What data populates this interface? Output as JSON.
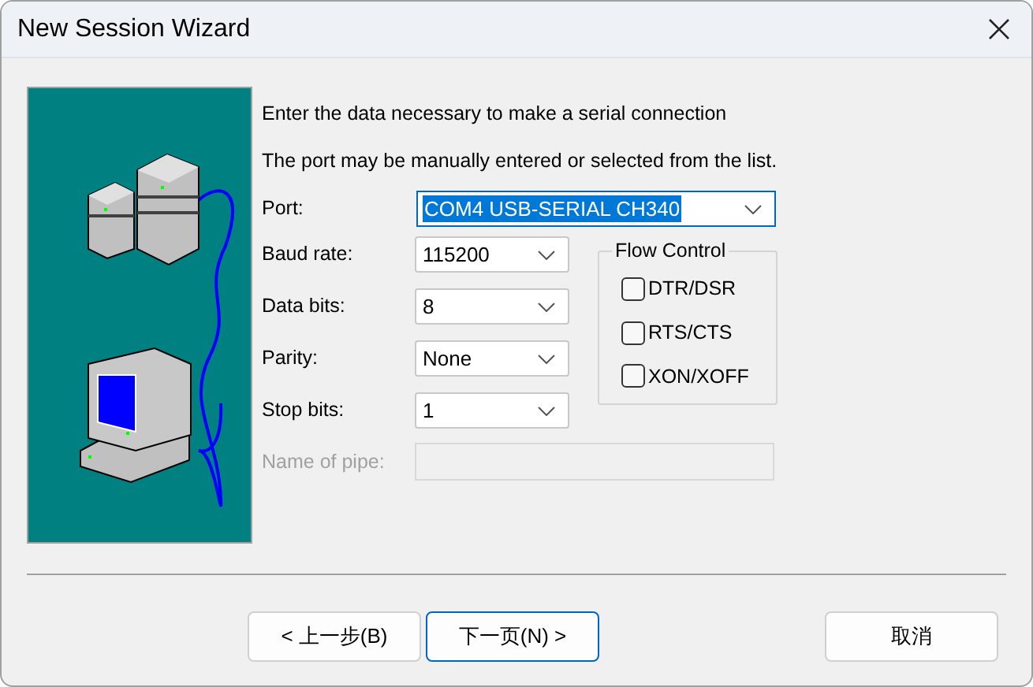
{
  "window": {
    "title": "New Session Wizard"
  },
  "intro": "Enter the data necessary to make a serial connection",
  "hint": "The port may be manually entered or selected from the list.",
  "port": {
    "label": "Port:",
    "value": "COM4 USB-SERIAL CH340",
    "focused": true
  },
  "fields": [
    {
      "label": "Baud rate:",
      "value": "115200",
      "focused": false
    },
    {
      "label": "Data bits:",
      "value": "8",
      "focused": false
    },
    {
      "label": "Parity:",
      "value": "None",
      "focused": false
    },
    {
      "label": "Stop bits:",
      "value": "1",
      "focused": false
    }
  ],
  "pipe": {
    "label": "Name of pipe:",
    "disabled": true
  },
  "flow_control": {
    "title": "Flow Control",
    "options": [
      {
        "label": "DTR/DSR",
        "checked": false
      },
      {
        "label": "RTS/CTS",
        "checked": false
      },
      {
        "label": "XON/XOFF",
        "checked": false
      }
    ]
  },
  "buttons": [
    {
      "label": "< 上一步(B)",
      "default": false
    },
    {
      "label": "下一页(N) >",
      "default": true
    },
    {
      "label": "取消",
      "default": false
    }
  ]
}
